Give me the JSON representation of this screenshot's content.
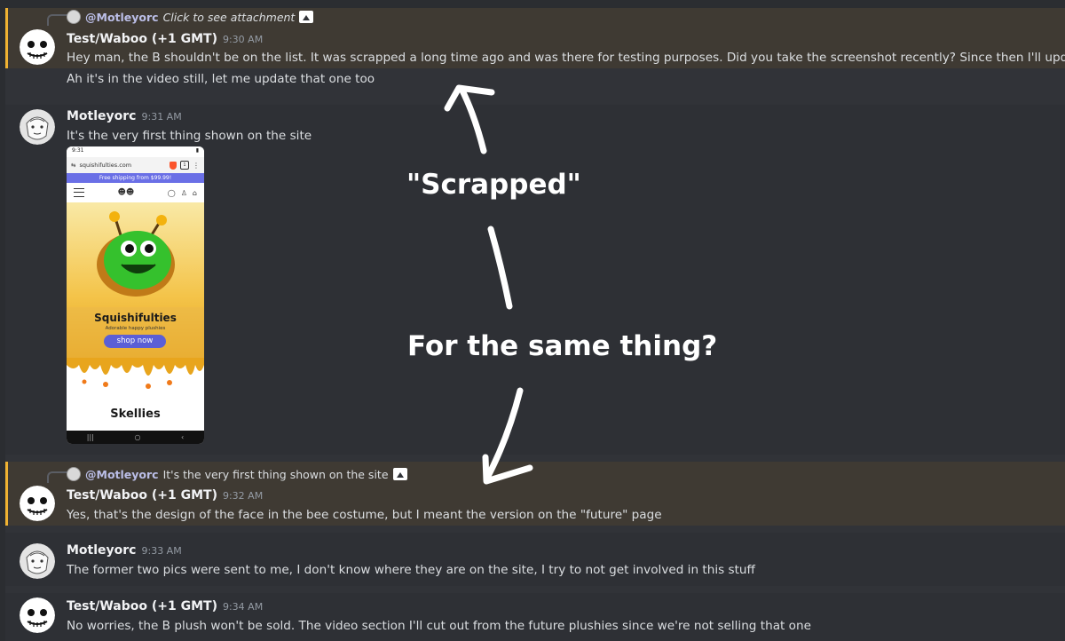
{
  "messages": [
    {
      "reply": {
        "mention": "@Motleyorc",
        "text": "Click to see attachment"
      },
      "username": "Test/Waboo (+1 GMT)",
      "time": "9:30 AM",
      "lines": [
        "Hey man, the B shouldn't be on the list. It was scrapped a long time ago and was there for testing purposes. Did you take the screenshot recently? Since then I'll update it",
        "Ah it's in the video still, let me update that one too"
      ]
    },
    {
      "username": "Motleyorc",
      "time": "9:31 AM",
      "lines": [
        "It's the very first thing shown on the site"
      ],
      "attachment": {
        "status_time": "9:31",
        "url": "squishifulties.com",
        "tab_count": "1",
        "banner": "Free shipping from $99.99!",
        "brand": "Squishifulties",
        "tagline": "Adorable happy plushies",
        "button": "shop now",
        "section": "Skellies"
      }
    },
    {
      "reply": {
        "mention": "@Motleyorc",
        "text": "It's the very first thing shown on the site"
      },
      "username": "Test/Waboo (+1 GMT)",
      "time": "9:32 AM",
      "lines": [
        "Yes, that's the design of the face in the bee costume, but I meant the version on the \"future\" page"
      ]
    },
    {
      "username": "Motleyorc",
      "time": "9:33 AM",
      "lines": [
        "The former two pics were sent to me, I don't know where they are on the site, I try to not get involved in this stuff"
      ]
    },
    {
      "username": "Test/Waboo (+1 GMT)",
      "time": "9:34 AM",
      "lines": [
        "No worries, the B plush won't be sold. The video section I'll cut out from the future plushies since we're not selling that one"
      ]
    }
  ],
  "annotations": {
    "scrapped": "\"Scrapped\"",
    "question": "For the same thing?"
  },
  "colors": {
    "background": "#313338",
    "highlight": "#3f3a33",
    "highlight_bar": "#f0b232",
    "username": "#f2f3f5",
    "timestamp": "#949ba4"
  }
}
